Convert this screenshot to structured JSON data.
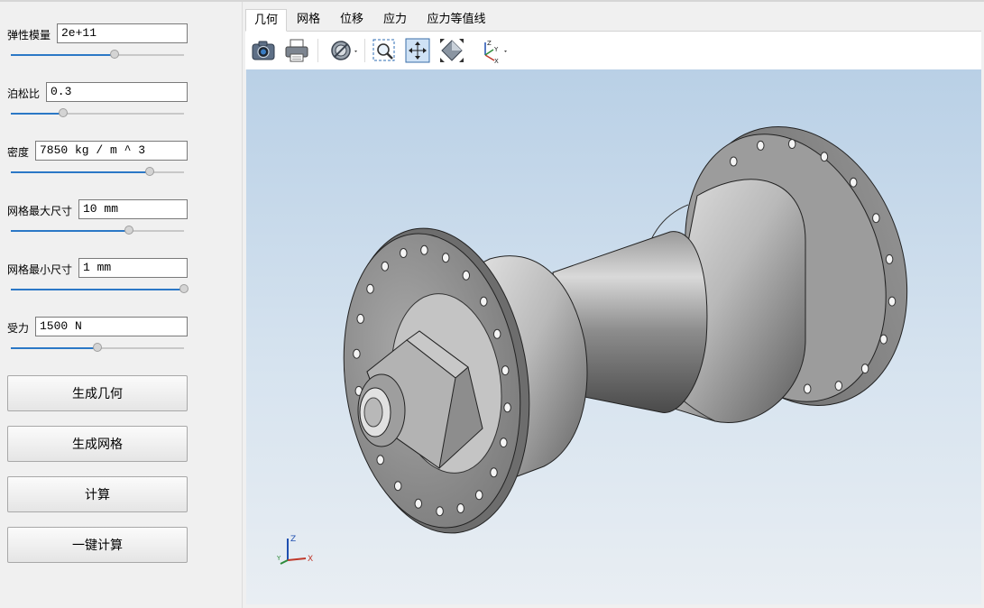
{
  "params": [
    {
      "label": "弹性模量",
      "value": "2e+11",
      "slider": 0.6
    },
    {
      "label": "泊松比",
      "value": "0.3",
      "slider": 0.3
    },
    {
      "label": "密度",
      "value": "7850 kg / m ^ 3",
      "slider": 0.8
    },
    {
      "label": "网格最大尺寸",
      "value": "10 mm",
      "slider": 0.68
    },
    {
      "label": "网格最小尺寸",
      "value": "1 mm",
      "slider": 1.0
    },
    {
      "label": "受力",
      "value": "1500 N",
      "slider": 0.5
    }
  ],
  "buttons": {
    "generate_geometry": "生成几何",
    "generate_mesh": "生成网格",
    "compute": "计算",
    "one_click_compute": "一键计算"
  },
  "tabs": [
    "几何",
    "网格",
    "位移",
    "应力",
    "应力等值线"
  ],
  "active_tab": "几何",
  "toolbar": {
    "icons": [
      "camera-icon",
      "print-icon",
      "view-mode-icon",
      "zoom-box-icon",
      "fit-all-icon",
      "perspective-icon",
      "axis-view-icon"
    ]
  },
  "axis_labels": {
    "z": "Z",
    "y": "Y",
    "x": "X"
  },
  "colors": {
    "accent": "#2b78c6",
    "viewport_top": "#b9d0e6",
    "viewport_bottom": "#e9eef3"
  }
}
